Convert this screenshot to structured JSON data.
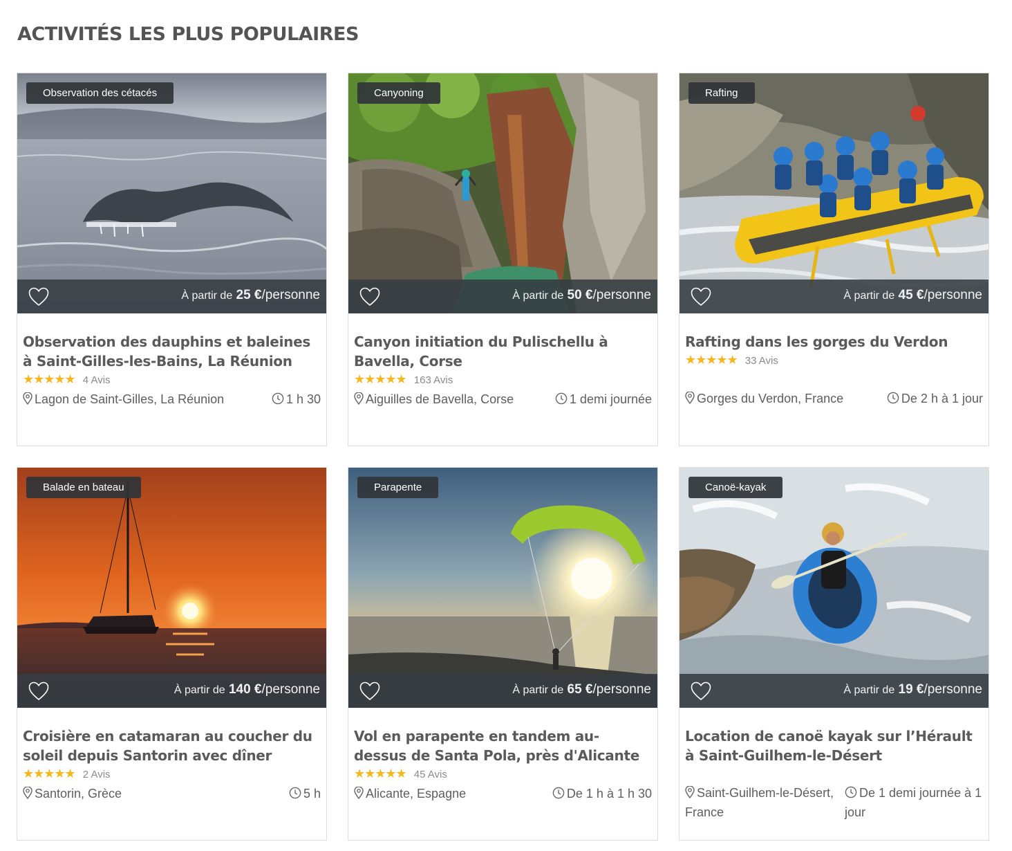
{
  "page": {
    "title": "ACTIVITÉS LES PLUS POPULAIRES"
  },
  "labels": {
    "from": "À partir de",
    "per_person": "/personne"
  },
  "colors": {
    "star": "#f5b71d",
    "title": "#545454",
    "badge_bg": "#303438"
  },
  "cards": [
    {
      "category": "Observation des cétacés",
      "price": "25 €",
      "title": "Observation des dauphins et baleines à Saint-Gilles-les-Bains, La Réunion",
      "stars": "★★★★★",
      "rating": 4.5,
      "reviews": "4 Avis",
      "location": "Lagon de Saint-Gilles, La Réunion",
      "duration": "1 h 30",
      "image_icon": "whale-tail-photo"
    },
    {
      "category": "Canyoning",
      "price": "50 €",
      "title": "Canyon initiation du Pulischellu à Bavella, Corse",
      "stars": "★★★★★",
      "rating": 5,
      "reviews": "163 Avis",
      "location": "Aiguilles de Bavella, Corse",
      "duration": "1 demi journée",
      "image_icon": "canyon-jump-photo"
    },
    {
      "category": "Rafting",
      "price": "45 €",
      "title": "Rafting dans les gorges du Verdon",
      "stars": "★★★★★",
      "rating": 5,
      "reviews": "33 Avis",
      "location": "Gorges du Verdon, France",
      "duration": "De 2 h à 1 jour",
      "image_icon": "raft-team-photo"
    },
    {
      "category": "Balade en bateau",
      "price": "140 €",
      "title": "Croisière en catamaran au coucher du soleil depuis Santorin avec dîner",
      "stars": "★★★★★",
      "rating": 5,
      "reviews": "2 Avis",
      "location": "Santorin, Grèce",
      "duration": "5 h",
      "image_icon": "sunset-catamaran-photo"
    },
    {
      "category": "Parapente",
      "price": "65 €",
      "title": "Vol en parapente en tandem au-dessus de Santa Pola, près d'Alicante",
      "stars": "★★★★★",
      "rating": 5,
      "reviews": "45 Avis",
      "location": "Alicante, Espagne",
      "duration": "De 1 h à 1 h 30",
      "image_icon": "paraglider-sunset-photo"
    },
    {
      "category": "Canoë-kayak",
      "price": "19 €",
      "title": "Location de canoë kayak sur l’Hérault à Saint-Guilhem-le-Désert",
      "stars": "",
      "rating": null,
      "reviews": "",
      "location": "Saint-Guilhem-le-Désert, France",
      "duration": "De 1 demi journée à 1 jour",
      "image_icon": "whitewater-kayak-photo"
    }
  ]
}
